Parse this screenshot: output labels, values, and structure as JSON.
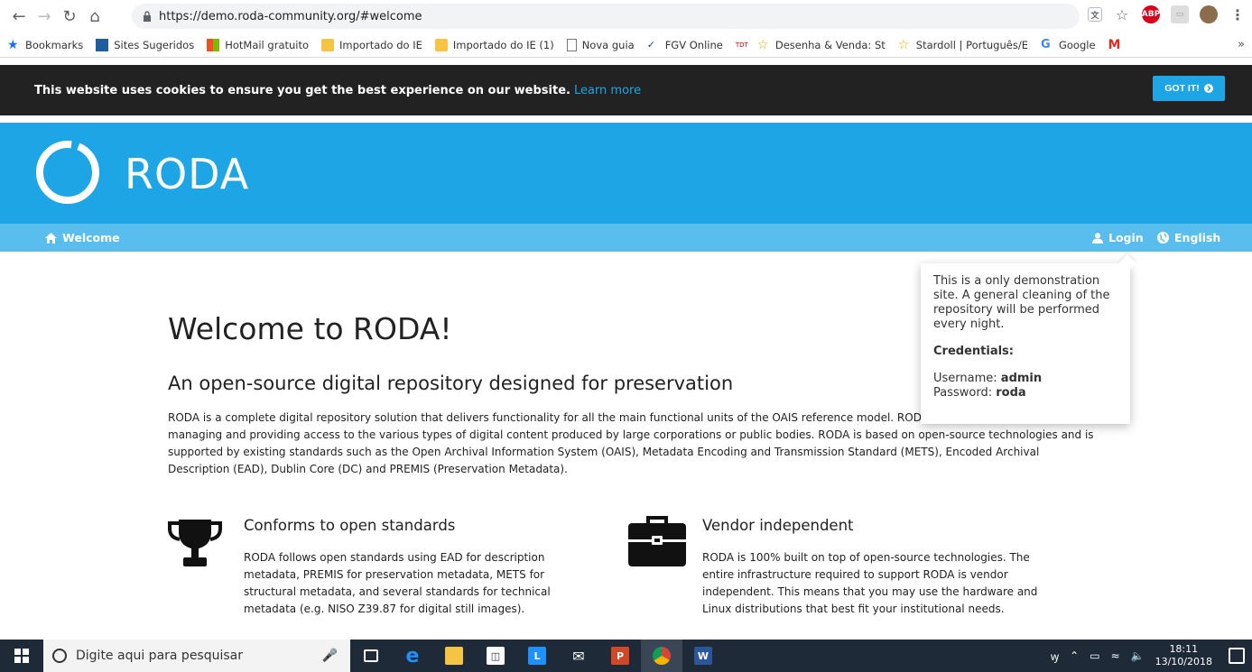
{
  "browser": {
    "url": "https://demo.roda-community.org/#welcome",
    "bookmarks": [
      {
        "label": "Bookmarks",
        "color": "#1a73e8"
      },
      {
        "label": "Sites Sugeridos",
        "color": "#1e5e9e"
      },
      {
        "label": "HotMail gratuito",
        "color": "#f25022"
      },
      {
        "label": "Importado do IE",
        "color": "#f6c342"
      },
      {
        "label": "Importado do IE (1)",
        "color": "#f6c342"
      },
      {
        "label": "Nova guia",
        "color": "#777777"
      },
      {
        "label": "FGV Online",
        "color": "#1c3d6e"
      },
      {
        "label": "Desenha & Venda: St",
        "color": "#e8a300"
      },
      {
        "label": "Stardoll | Português/E",
        "color": "#e8a300"
      },
      {
        "label": "Google",
        "color": "#4285f4"
      },
      {
        "label": "M",
        "color": "#d93025"
      }
    ],
    "more": "»"
  },
  "cookie": {
    "text": "This website uses cookies to ensure you get the best experience on our website.",
    "link": "Learn more",
    "button": "GOT IT!"
  },
  "header": {
    "brand": "RODA"
  },
  "nav": {
    "welcome": "Welcome",
    "login": "Login",
    "language": "English"
  },
  "main": {
    "title": "Welcome to RODA!",
    "subtitle": "An open-source digital repository designed for preservation",
    "intro": "RODA is a complete digital repository solution that delivers functionality for all the main functional units of the OAIS reference model. RODA is capable of ingesting, managing and providing access to the various types of digital content produced by large corporations or public bodies. RODA is based on open-source technologies and is supported by existing standards such as the Open Archival Information System (OAIS), Metadata Encoding and Transmission Standard (METS), Encoded Archival Description (EAD), Dublin Core (DC) and PREMIS (Preservation Metadata).",
    "features": [
      {
        "title": "Conforms to open standards",
        "text": "RODA follows open standards using EAD for description metadata, PREMIS for preservation metadata, METS for structural metadata, and several standards for technical metadata (e.g. NISO Z39.87 for digital still images).",
        "icon": "trophy-icon"
      },
      {
        "title": "Vendor independent",
        "text": "RODA is 100% built on top of open-source technologies. The entire infrastructure required to support RODA is vendor independent. This means that you may use the hardware and Linux distributions that best fit your institutional needs.",
        "icon": "briefcase-icon"
      }
    ]
  },
  "popover": {
    "message": "This is a only demonstration site. A general cleaning of the repository will be performed every night.",
    "credentials_title": "Credentials:",
    "username_label": "Username:",
    "username": "admin",
    "password_label": "Password:",
    "password": "roda"
  },
  "taskbar": {
    "search_placeholder": "Digite aqui para pesquisar",
    "time": "18:11",
    "date": "13/10/2018"
  },
  "colors": {
    "accent": "#1ea5e6",
    "nav": "#59bdee",
    "cookie_bg": "#222222"
  }
}
